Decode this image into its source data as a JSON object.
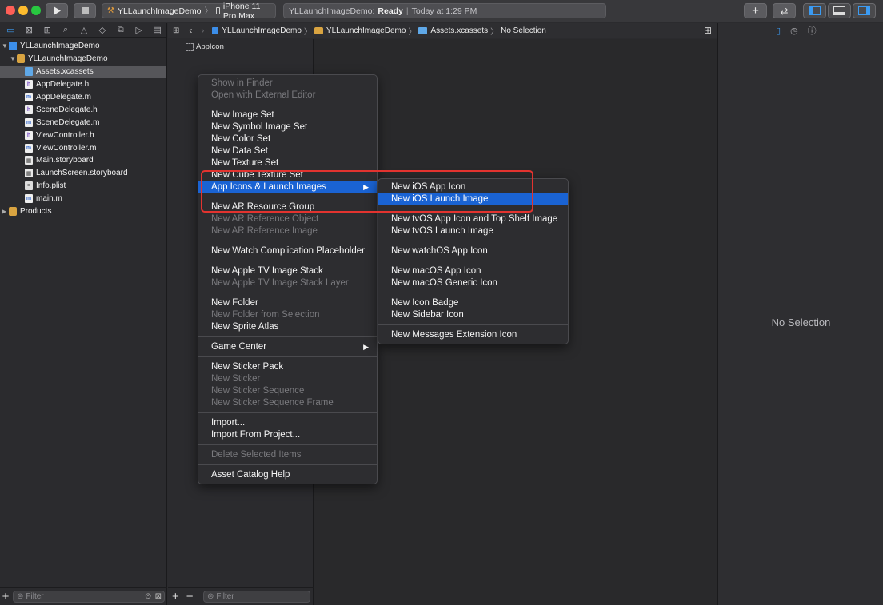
{
  "toolbar": {
    "scheme_project": "YLLaunchImageDemo",
    "scheme_device": "iPhone 11 Pro Max",
    "status_project": "YLLaunchImageDemo:",
    "status_state": "Ready",
    "status_time": "Today at 1:29 PM"
  },
  "navigator": {
    "items": [
      {
        "label": "YLLaunchImageDemo",
        "icon": "project-icon",
        "level": 0,
        "disclosure": "▼"
      },
      {
        "label": "YLLaunchImageDemo",
        "icon": "folder-icon",
        "level": 1,
        "disclosure": "▼"
      },
      {
        "label": "Assets.xcassets",
        "icon": "asset-catalog-icon",
        "level": 2,
        "selected": true
      },
      {
        "label": "AppDelegate.h",
        "icon": "header-file-icon",
        "level": 2
      },
      {
        "label": "AppDelegate.m",
        "icon": "source-file-icon",
        "level": 2
      },
      {
        "label": "SceneDelegate.h",
        "icon": "header-file-icon",
        "level": 2
      },
      {
        "label": "SceneDelegate.m",
        "icon": "source-file-icon",
        "level": 2
      },
      {
        "label": "ViewController.h",
        "icon": "header-file-icon",
        "level": 2
      },
      {
        "label": "ViewController.m",
        "icon": "source-file-icon",
        "level": 2
      },
      {
        "label": "Main.storyboard",
        "icon": "storyboard-icon",
        "level": 2
      },
      {
        "label": "LaunchScreen.storyboard",
        "icon": "storyboard-icon",
        "level": 2
      },
      {
        "label": "Info.plist",
        "icon": "plist-icon",
        "level": 2
      },
      {
        "label": "main.m",
        "icon": "source-file-icon",
        "level": 2
      },
      {
        "label": "Products",
        "icon": "folder-icon",
        "level": 0,
        "disclosure": "▶"
      }
    ],
    "filter_placeholder": "Filter"
  },
  "jumpbar": {
    "crumbs": [
      "YLLaunchImageDemo",
      "YLLaunchImageDemo",
      "Assets.xcassets",
      "No Selection"
    ]
  },
  "assetlist": {
    "item": "AppIcon",
    "filter_placeholder": "Filter"
  },
  "inspector": {
    "empty_label": "No Selection"
  },
  "context_menu": {
    "groups": [
      [
        {
          "label": "Show in Finder",
          "disabled": true
        },
        {
          "label": "Open with External Editor",
          "disabled": true
        }
      ],
      [
        {
          "label": "New Image Set"
        },
        {
          "label": "New Symbol Image Set"
        },
        {
          "label": "New Color Set"
        },
        {
          "label": "New Data Set"
        },
        {
          "label": "New Texture Set"
        },
        {
          "label": "New Cube Texture Set"
        },
        {
          "label": "App Icons & Launch Images",
          "submenu": true,
          "highlight": true
        }
      ],
      [
        {
          "label": "New AR Resource Group"
        },
        {
          "label": "New AR Reference Object",
          "disabled": true
        },
        {
          "label": "New AR Reference Image",
          "disabled": true
        }
      ],
      [
        {
          "label": "New Watch Complication Placeholder"
        }
      ],
      [
        {
          "label": "New Apple TV Image Stack"
        },
        {
          "label": "New Apple TV Image Stack Layer",
          "disabled": true
        }
      ],
      [
        {
          "label": "New Folder"
        },
        {
          "label": "New Folder from Selection",
          "disabled": true
        },
        {
          "label": "New Sprite Atlas"
        }
      ],
      [
        {
          "label": "Game Center",
          "submenu": true
        }
      ],
      [
        {
          "label": "New Sticker Pack"
        },
        {
          "label": "New Sticker",
          "disabled": true
        },
        {
          "label": "New Sticker Sequence",
          "disabled": true
        },
        {
          "label": "New Sticker Sequence Frame",
          "disabled": true
        }
      ],
      [
        {
          "label": "Import..."
        },
        {
          "label": "Import From Project..."
        }
      ],
      [
        {
          "label": "Delete Selected Items",
          "disabled": true
        }
      ],
      [
        {
          "label": "Asset Catalog Help"
        }
      ]
    ]
  },
  "submenu": {
    "groups": [
      [
        {
          "label": "New iOS App Icon"
        },
        {
          "label": "New iOS Launch Image",
          "highlight": true
        }
      ],
      [
        {
          "label": "New tvOS App Icon and Top Shelf Image"
        },
        {
          "label": "New tvOS Launch Image"
        }
      ],
      [
        {
          "label": "New watchOS App Icon"
        }
      ],
      [
        {
          "label": "New macOS App Icon"
        },
        {
          "label": "New macOS Generic Icon"
        }
      ],
      [
        {
          "label": "New Icon Badge"
        },
        {
          "label": "New Sidebar Icon"
        }
      ],
      [
        {
          "label": "New Messages Extension Icon"
        }
      ]
    ]
  },
  "colors": {
    "menu_highlight": "#1a63d3",
    "annotation_box": "#e2332f",
    "accent": "#3b9bf3"
  }
}
